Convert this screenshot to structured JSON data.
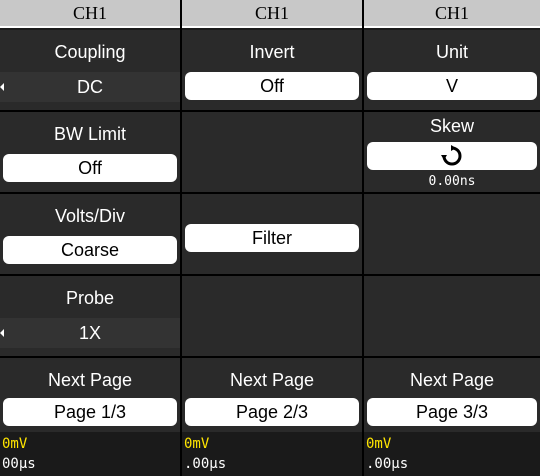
{
  "col1": {
    "channel": "CH1",
    "coupling": {
      "label": "Coupling",
      "value": "DC"
    },
    "bw_limit": {
      "label": "BW Limit",
      "value": "Off"
    },
    "volts_div": {
      "label": "Volts/Div",
      "value": "Coarse"
    },
    "probe": {
      "label": "Probe",
      "value": "1X"
    },
    "next_page": {
      "label": "Next Page",
      "value": "Page 1/3"
    },
    "status_line1": "0mV",
    "status_line2": "00μs"
  },
  "col2": {
    "channel": "CH1",
    "invert": {
      "label": "Invert",
      "value": "Off"
    },
    "filter": {
      "label": "Filter"
    },
    "next_page": {
      "label": "Next Page",
      "value": "Page 2/3"
    },
    "status_line1": "0mV",
    "status_line2": ".00μs"
  },
  "col3": {
    "channel": "CH1",
    "unit": {
      "label": "Unit",
      "value": "V"
    },
    "skew": {
      "label": "Skew",
      "value": "0.00ns",
      "icon": "rotate-icon"
    },
    "next_page": {
      "label": "Next Page",
      "value": "Page 3/3"
    },
    "status_line1": "0mV",
    "status_line2": ".00μs"
  }
}
